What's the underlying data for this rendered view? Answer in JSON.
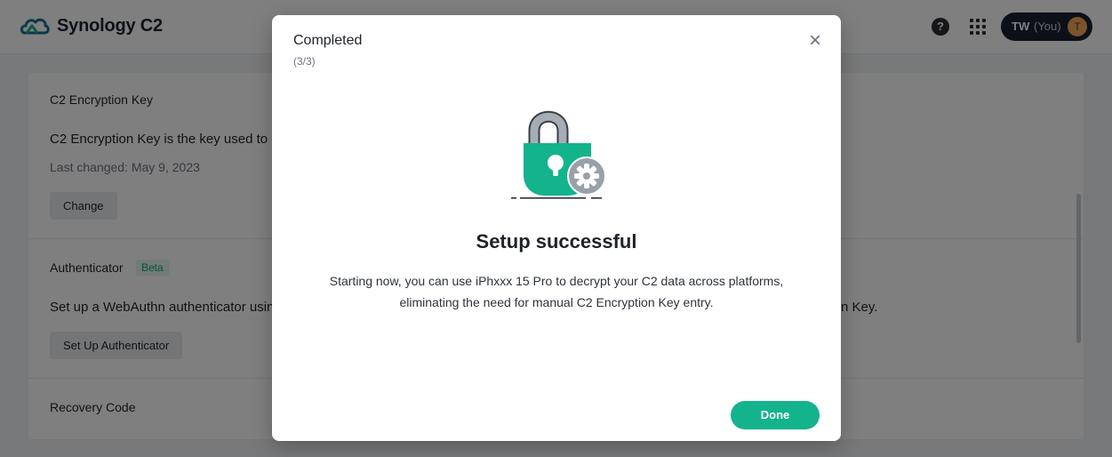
{
  "header": {
    "app_title": "Synology C2",
    "help_glyph": "?",
    "user": {
      "initials": "TW",
      "you_label": "(You)",
      "avatar_letter": "T"
    }
  },
  "page": {
    "encryption": {
      "title": "C2 Encryption Key",
      "description": "C2 Encryption Key is the key used to e",
      "last_changed": "Last changed: May 9, 2023",
      "button": "Change"
    },
    "authenticator": {
      "title": "Authenticator",
      "badge": "Beta",
      "description_left": "Set up a WebAuthn authenticator usin",
      "description_right": "n Key.",
      "button": "Set Up Authenticator"
    },
    "recovery": {
      "title": "Recovery Code"
    }
  },
  "dialog": {
    "title": "Completed",
    "step": "(3/3)",
    "heading": "Setup successful",
    "body_line1": "Starting now, you can use iPhxxx 15 Pro to decrypt your C2 data across platforms,",
    "body_line2": "eliminating the need for manual C2 Encryption Key entry.",
    "done": "Done",
    "close_glyph": "×"
  },
  "colors": {
    "accent": "#13b38c",
    "lock_body": "#13b38c",
    "lock_shackle": "#8e949d",
    "gear": "#9aa0a8",
    "header_chip": "#1b2130",
    "avatar": "#f5a85a"
  },
  "icons": [
    "synology-c2-logo-icon",
    "help-icon",
    "apps-grid-icon",
    "close-icon",
    "lock-icon",
    "gear-icon"
  ]
}
